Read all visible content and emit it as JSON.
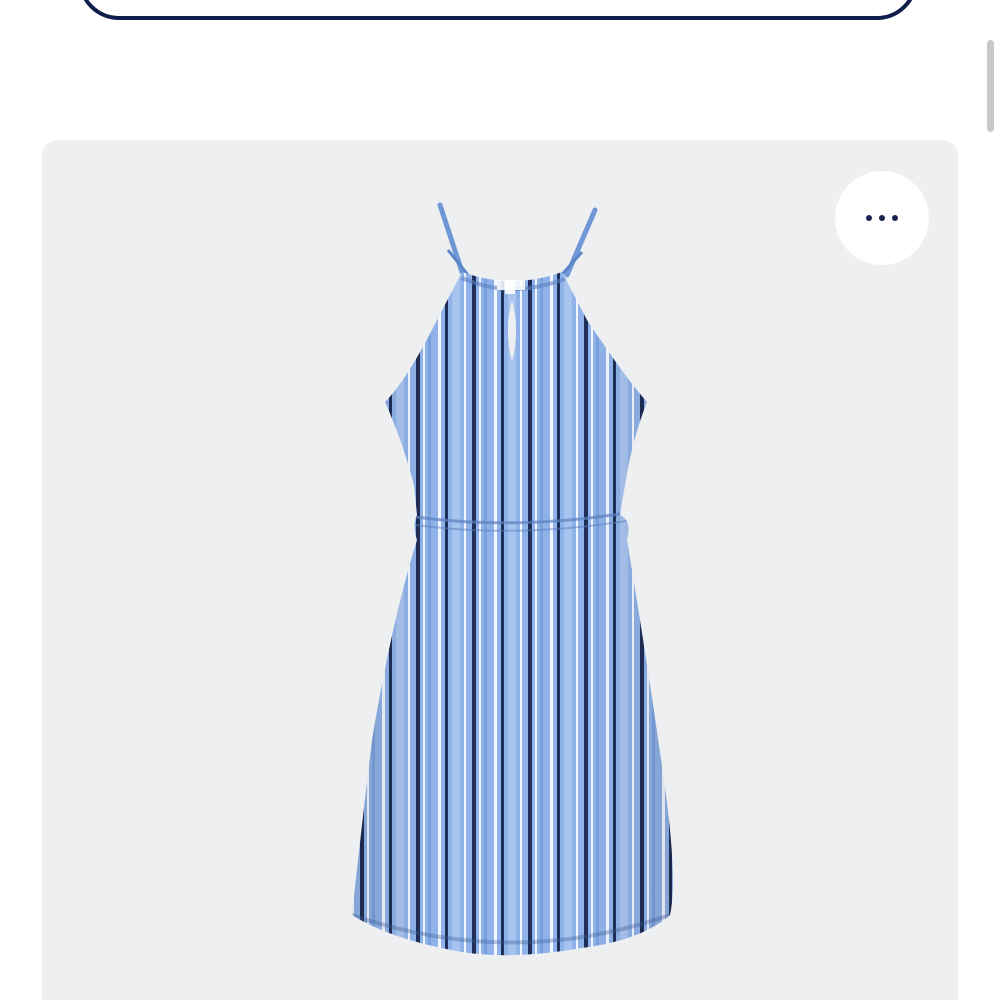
{
  "top_button": {
    "label": ""
  },
  "product": {
    "image_icon": "striped-halter-dress-image",
    "more_options_icon": "more-horizontal-icon",
    "colors": {
      "card_background": "#eeeff1",
      "dress_base": "#8fb3e8",
      "stripe_dark": "#1f2e5a",
      "stripe_white": "#f4f7ff",
      "button_border": "#0f1d4d"
    }
  }
}
